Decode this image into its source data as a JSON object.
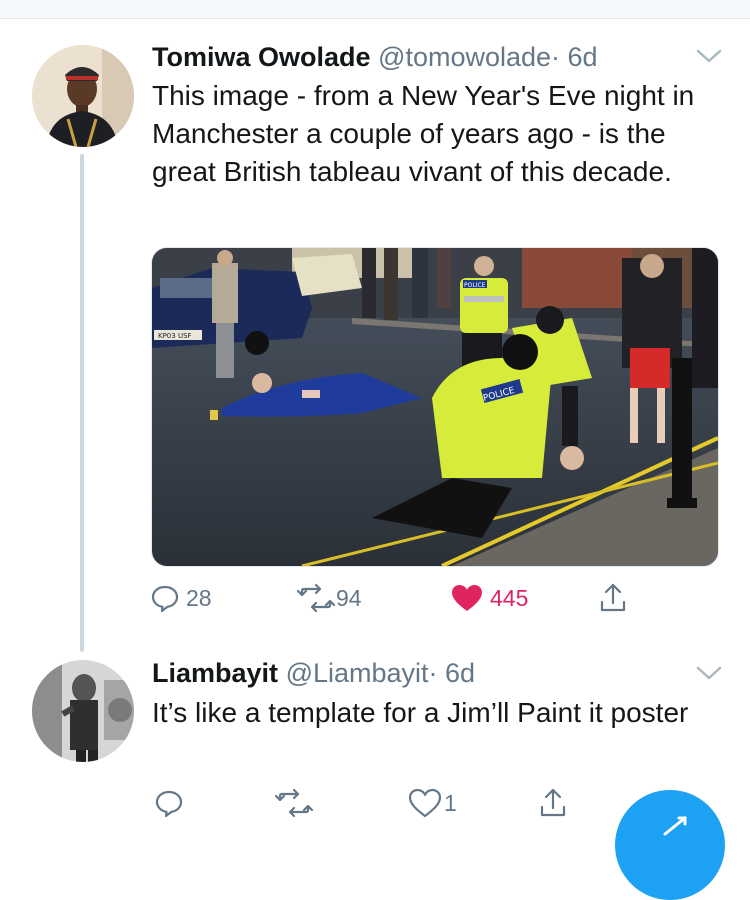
{
  "tweets": [
    {
      "name": "Tomiwa Owolade",
      "handle": "@tomowolade",
      "time": "· 6d",
      "text": "This image - from a New Year's Eve night in Manchester a couple of years ago - is the great British tableau vivant of this decade.",
      "media": {
        "car_plate": "KP03 USF",
        "police_label_1": "POLICE",
        "police_label_2": "POLICE"
      },
      "actions": {
        "replies": "28",
        "retweets": "94",
        "likes": "445"
      }
    },
    {
      "name": "Liambayit",
      "handle": "@Liambayit",
      "time": "· 6d",
      "text": "It’s like a template for a Jim’ll Paint it poster",
      "actions": {
        "replies": "",
        "retweets": "",
        "likes": "1"
      }
    }
  ],
  "colors": {
    "like_red": "#e0245e",
    "muted_gray": "#657786",
    "thread_line": "#ccd6dd",
    "compose_blue": "#1da1f2"
  },
  "icons": [
    "reply-icon",
    "retweet-icon",
    "like-icon",
    "share-icon",
    "chevron-down-icon",
    "compose-icon"
  ]
}
